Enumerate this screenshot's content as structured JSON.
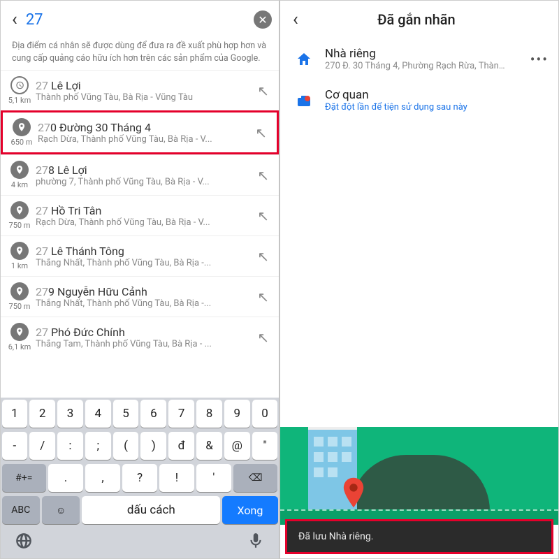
{
  "left": {
    "search_value": "27",
    "info": "Địa điểm cá nhân sẽ được dùng để đưa ra đề xuất phù hợp hơn và cung cấp quảng cáo hữu ích hơn trên các sản phẩm của Google.",
    "suggestions": [
      {
        "distance": "5,1 km",
        "q": "27",
        "rest": " Lê Lợi",
        "sub": "Thành phố Vũng Tàu, Bà Rịa - Vũng Tàu",
        "history": true
      },
      {
        "distance": "650 m",
        "q": "27",
        "rest": "0 Đường 30 Tháng 4",
        "sub": "Rạch Dừa, Thành phố Vũng Tàu, Bà Rịa - V...",
        "highlight": true
      },
      {
        "distance": "4 km",
        "q": "27",
        "rest": "8 Lê Lợi",
        "sub": "phường 7, Thành phố Vũng Tàu, Bà Rịa - V..."
      },
      {
        "distance": "750 m",
        "q": "27",
        "rest": " Hồ Tri Tân",
        "sub": "Rạch Dừa, Thành phố Vũng Tàu, Bà Rịa - V..."
      },
      {
        "distance": "1 km",
        "q": "27",
        "rest": " Lê Thánh Tông",
        "sub": "Thắng Nhất, Thành phố Vũng Tàu, Bà Rịa -..."
      },
      {
        "distance": "750 m",
        "q": "27",
        "rest": "9 Nguyễn Hữu Cảnh",
        "sub": "Thắng Nhất, Thành phố Vũng Tàu, Bà Rịa -..."
      },
      {
        "distance": "6,1 km",
        "q": "27",
        "rest": " Phó Đức Chính",
        "sub": "Thắng Tam, Thành phố Vũng Tàu, Bà Rịa - ..."
      }
    ],
    "keyboard": {
      "row1": [
        "1",
        "2",
        "3",
        "4",
        "5",
        "6",
        "7",
        "8",
        "9",
        "0"
      ],
      "row2": [
        "-",
        "/",
        ":",
        ";",
        "(",
        ")",
        "đ",
        "&",
        "@",
        "\""
      ],
      "row3_hash": "#+=",
      "row3": [
        ".",
        ",",
        "?",
        "!",
        "'"
      ],
      "row3_back": "⌫",
      "abc": "ABC",
      "space": "dấu cách",
      "done": "Xong"
    }
  },
  "right": {
    "title": "Đã gắn nhãn",
    "labels": [
      {
        "name": "Nhà riêng",
        "sub": "270 Đ. 30 Tháng 4, Phường Rạch Rừa, Thành...",
        "icon": "home",
        "more": true
      },
      {
        "name": "Cơ quan",
        "sub": "Đặt đột lần để tiện sử dụng sau này",
        "icon": "work",
        "blue": true
      }
    ],
    "toast": "Đã lưu Nhà riêng."
  }
}
